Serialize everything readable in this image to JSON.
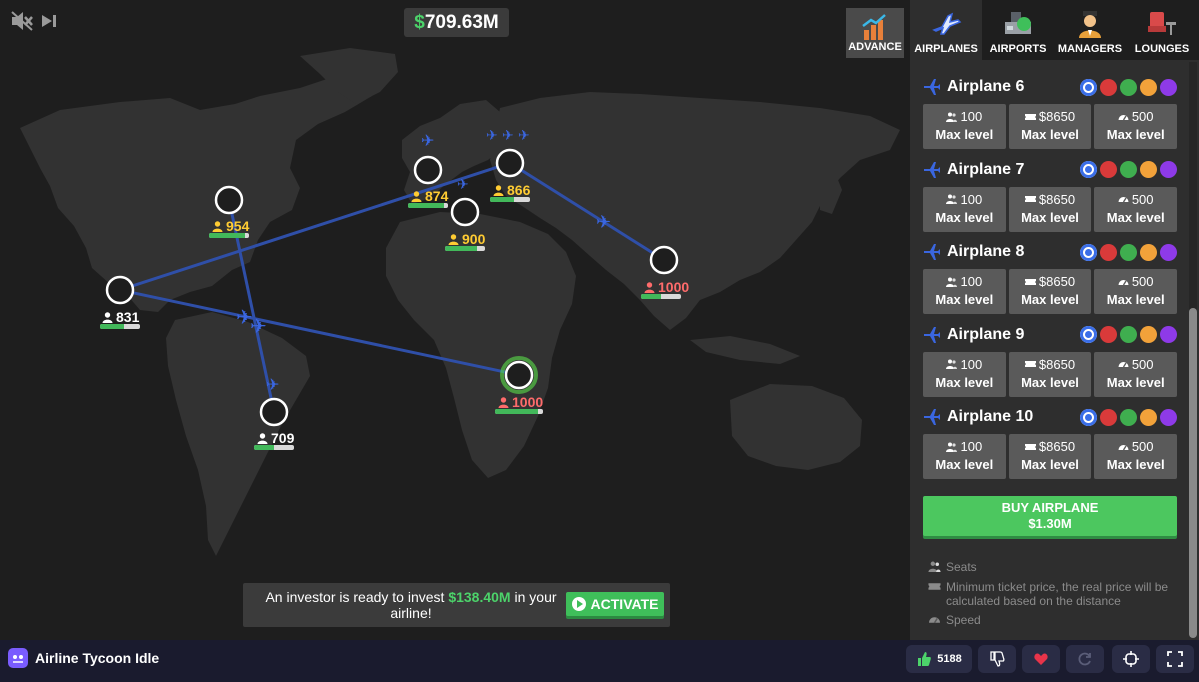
{
  "top": {
    "money": "709.63M",
    "money_symbol": "$",
    "sound_icon": "mute-icon",
    "skip_icon": "skip-icon"
  },
  "tabs": [
    {
      "label": "ADVANCE",
      "icon": "chart-icon"
    },
    {
      "label": "AIRPLANES",
      "icon": "airplane-icon",
      "active": true
    },
    {
      "label": "AIRPORTS",
      "icon": "airport-icon"
    },
    {
      "label": "MANAGERS",
      "icon": "manager-icon"
    },
    {
      "label": "LOUNGES",
      "icon": "lounge-icon"
    }
  ],
  "cities": [
    {
      "count": "954",
      "color": "yellow",
      "fill": 0.9
    },
    {
      "count": "831",
      "color": "white",
      "fill": 0.6
    },
    {
      "count": "709",
      "color": "white",
      "fill": 0.5
    },
    {
      "count": "874",
      "color": "yellow",
      "fill": 0.9
    },
    {
      "count": "900",
      "color": "yellow",
      "fill": 0.8
    },
    {
      "count": "866",
      "color": "yellow",
      "fill": 0.6
    },
    {
      "count": "1000",
      "color": "red",
      "fill": 0.5
    },
    {
      "count": "1000",
      "color": "red",
      "fill": 0.9
    }
  ],
  "investor": {
    "text_before": "An investor is ready to invest ",
    "amount": "$138.40M",
    "text_after": " in your airline!",
    "button": "ACTIVATE"
  },
  "airplanes": [
    {
      "name": "Airplane 6",
      "seats": "100",
      "price": "$8650",
      "speed": "500",
      "level": "Max level"
    },
    {
      "name": "Airplane 7",
      "seats": "100",
      "price": "$8650",
      "speed": "500",
      "level": "Max level"
    },
    {
      "name": "Airplane 8",
      "seats": "100",
      "price": "$8650",
      "speed": "500",
      "level": "Max level"
    },
    {
      "name": "Airplane 9",
      "seats": "100",
      "price": "$8650",
      "speed": "500",
      "level": "Max level"
    },
    {
      "name": "Airplane 10",
      "seats": "100",
      "price": "$8650",
      "speed": "500",
      "level": "Max level"
    }
  ],
  "plane_colors": [
    "#3a6ee8",
    "#d93a3a",
    "#3fae4f",
    "#f2a23a",
    "#8e3ae8"
  ],
  "buy": {
    "label": "BUY AIRPLANE",
    "price": "$1.30M"
  },
  "legend": {
    "seats": "Seats",
    "price": "Minimum ticket price, the real price will be calculated based on the distance",
    "speed": "Speed"
  },
  "bottom": {
    "title": "Airline Tycoon Idle",
    "likes": "5188"
  },
  "colors": {
    "route": "#2f4fa8",
    "plane": "#3a66e0",
    "land": "#323232",
    "ocean": "#1e1e1e",
    "green": "#4cc75f"
  }
}
